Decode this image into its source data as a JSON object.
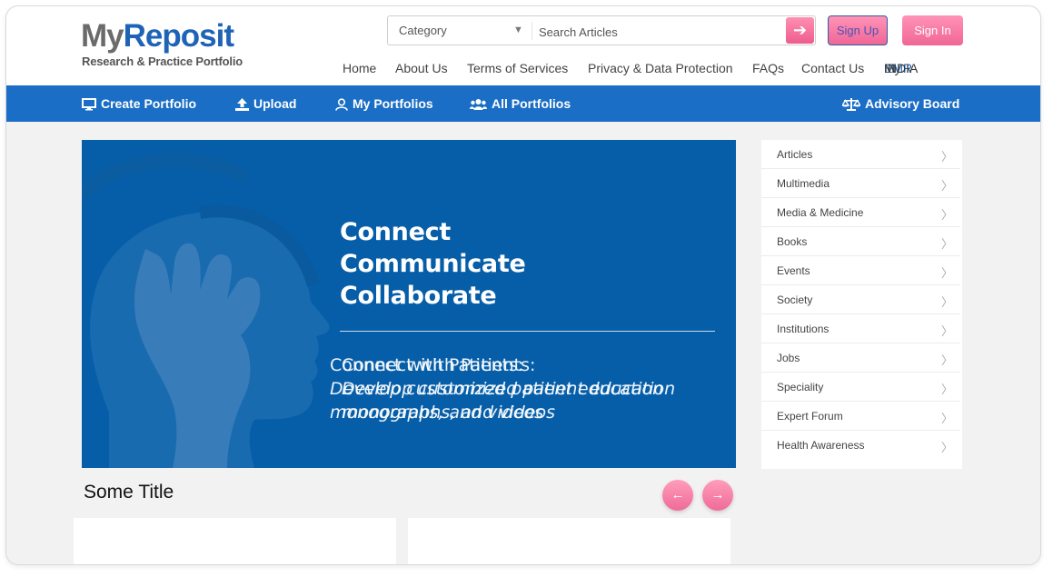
{
  "header": {
    "logo_main_1": "My",
    "logo_main_2": "Reposit",
    "logo_sub": "Research & Practice Portfolio",
    "category_label": "Category",
    "search_placeholder": "Search Articles",
    "signup": "Sign Up",
    "signin": "Sign In",
    "nav": [
      "Home",
      "About Us",
      "Terms of Services",
      "Privacy & Data Protection",
      "FAQs",
      "Contact Us"
    ],
    "emr_my": "My",
    "emr_mid": "EMR",
    "emr_end": "INDIA"
  },
  "bluebar": {
    "create": "Create Portfolio",
    "upload": "Upload",
    "my_portfolios": "My Portfolios",
    "all_portfolios": "All Portfolios",
    "advisory": "Advisory Board"
  },
  "slider": {
    "heading_1": "Connect",
    "heading_2": "Communicate",
    "heading_3": "Collaborate",
    "text_a_1": "Connect with Patients:",
    "text_a_2": "Develop customized patient education",
    "text_a_3": "monographs, and videos",
    "text_b_1": "Connect with Patients:",
    "text_b_2": "Develop customized patient education",
    "text_b_3": "monographs, and videos"
  },
  "section": {
    "title": "Some Title"
  },
  "sidebar": {
    "items": [
      {
        "label": "Articles"
      },
      {
        "label": "Multimedia"
      },
      {
        "label": "Media & Medicine"
      },
      {
        "label": "Books"
      },
      {
        "label": "Events"
      },
      {
        "label": "Society"
      },
      {
        "label": "Institutions"
      },
      {
        "label": "Jobs"
      },
      {
        "label": "Speciality"
      },
      {
        "label": "Expert Forum"
      },
      {
        "label": "Health Awareness"
      }
    ]
  },
  "colors": {
    "brand_blue": "#1a6ec5",
    "slider_blue": "#065ea8",
    "pink": "#f06696"
  }
}
